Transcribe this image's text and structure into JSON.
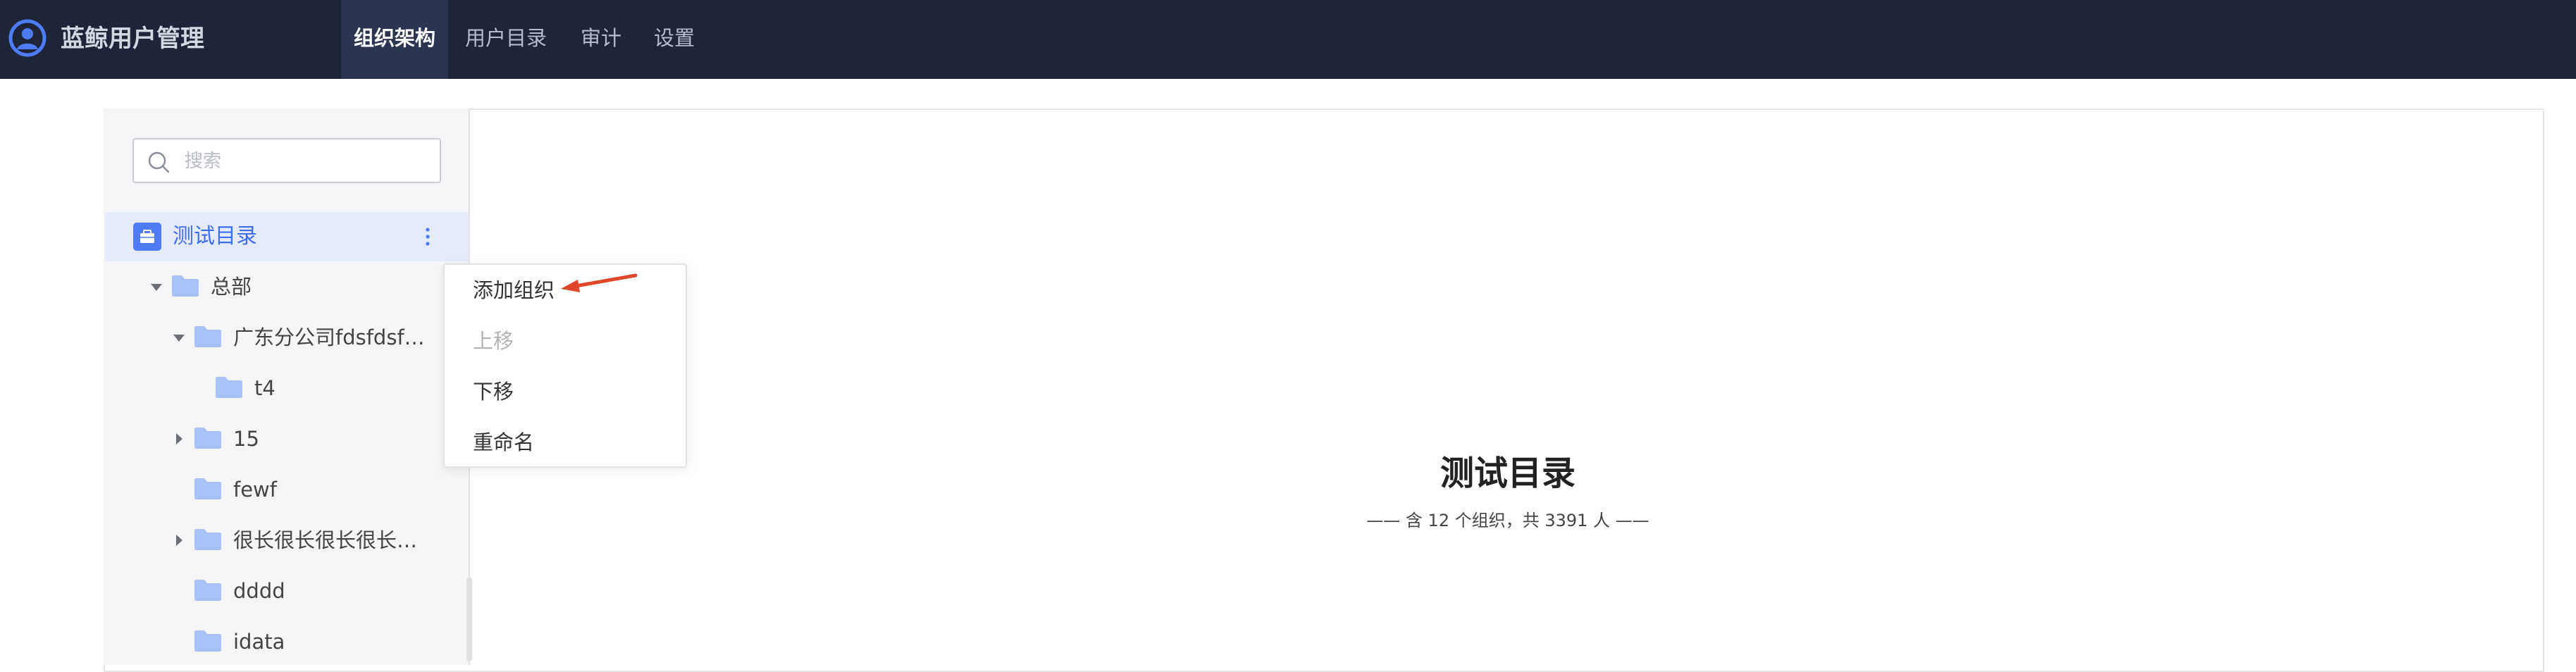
{
  "app": {
    "title": "蓝鲸用户管理"
  },
  "nav": {
    "items": [
      {
        "label": "组织架构",
        "active": true
      },
      {
        "label": "用户目录",
        "active": false
      },
      {
        "label": "审计",
        "active": false
      },
      {
        "label": "设置",
        "active": false
      }
    ]
  },
  "sidebar": {
    "search": {
      "placeholder": "搜索",
      "value": ""
    },
    "root": {
      "label": "测试目录"
    },
    "tree": [
      {
        "label": "总部",
        "expander": "expanded"
      },
      {
        "label": "广东分公司fdsfdsf…",
        "expander": "expanded"
      },
      {
        "label": "t4",
        "expander": "none"
      },
      {
        "label": "15",
        "expander": "collapsed"
      },
      {
        "label": "fewf",
        "expander": "none"
      },
      {
        "label": "很长很长很长很长…",
        "expander": "collapsed"
      },
      {
        "label": "dddd",
        "expander": "none"
      },
      {
        "label": "idata",
        "expander": "none"
      }
    ]
  },
  "context_menu": {
    "items": [
      {
        "label": "添加组织",
        "disabled": false
      },
      {
        "label": "上移",
        "disabled": true
      },
      {
        "label": "下移",
        "disabled": false
      },
      {
        "label": "重命名",
        "disabled": false
      }
    ]
  },
  "main": {
    "title": "测试目录",
    "subtitle": "—— 含 12 个组织，共 3391 人 ——"
  },
  "colors": {
    "topbar": "#1e2539",
    "accent": "#3c6ff0",
    "folder": "#a9c2f7",
    "annotation_arrow": "#e0462c"
  },
  "icons": {
    "logo": "user-circle-icon",
    "search": "search-icon",
    "root": "directory-icon",
    "more": "more-vertical-icon",
    "folder": "folder-icon",
    "caret_expanded": "caret-down-icon",
    "caret_collapsed": "caret-right-icon",
    "annotation": "arrow-annotation-icon"
  }
}
